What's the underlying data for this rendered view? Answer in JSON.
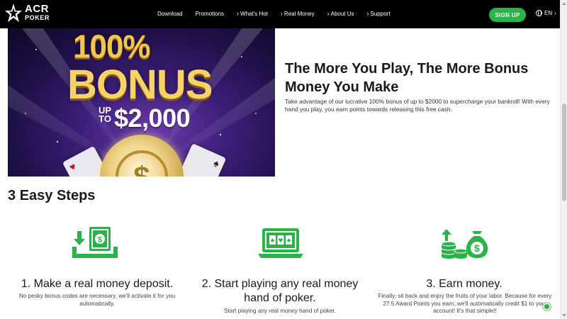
{
  "header": {
    "logo_top": "ACR",
    "logo_bottom": "POKER",
    "nav": [
      {
        "label": "Download",
        "chevron": false
      },
      {
        "label": "Promotions",
        "chevron": false
      },
      {
        "label": "What's Hot",
        "chevron": true
      },
      {
        "label": "Real Money",
        "chevron": true
      },
      {
        "label": "About Us",
        "chevron": true
      },
      {
        "label": "Support",
        "chevron": true
      }
    ],
    "signup_label": "SIGN UP",
    "language": "EN"
  },
  "hero": {
    "image_text": {
      "percent": "100%",
      "bonus": "BONUS",
      "up": "UP",
      "to": "TO",
      "amount": "$2,000"
    },
    "title": "The More You Play, The More Bonus Money You Make",
    "body": "Take advantage of our lucrative 100% bonus of up to $2000 to supercharge your bankroll! With every hand you play, you earn points towards releasing this free cash."
  },
  "steps_heading": {
    "prefix": "3 ",
    "bold": "Easy",
    "suffix": " Steps"
  },
  "steps": [
    {
      "icon": "money-deposit-icon",
      "title": "1. Make a real money deposit.",
      "desc": "No pesky bonus codes are necessary, we'll activate it for you automatically."
    },
    {
      "icon": "laptop-cards-icon",
      "title": "2. Start playing any real money hand of poker.",
      "desc": "Start playing any real money hand of poker."
    },
    {
      "icon": "money-bag-chips-icon",
      "title": "3. Earn money.",
      "desc": "Finally, sit back and enjoy the fruits of your labor. Because for every 27.5 Award Points you earn, we'll automatically credit $1 to your account! It's that simple!!"
    }
  ],
  "colors": {
    "accent_green": "#2bb34a",
    "header_bg": "#000000",
    "gold": "#f3c74b",
    "purple": "#3d1f7a"
  }
}
